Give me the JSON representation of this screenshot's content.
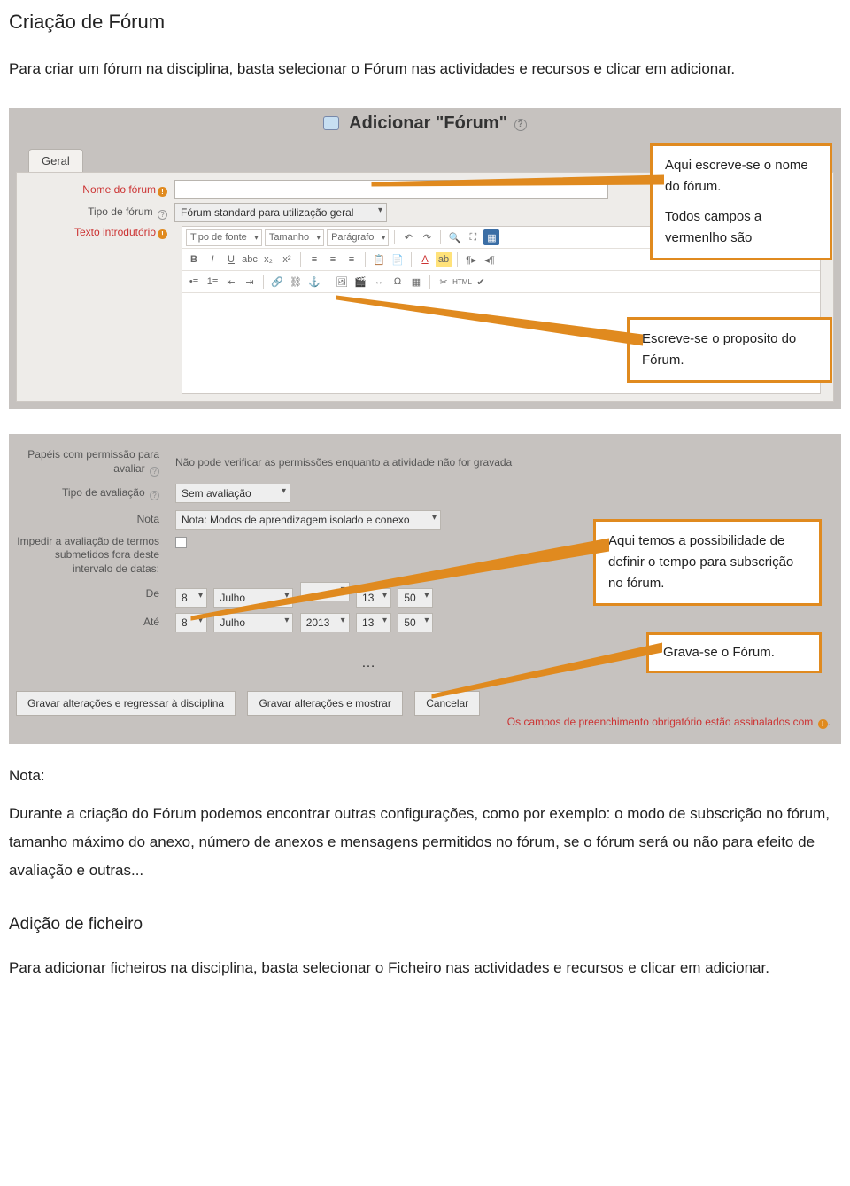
{
  "doc": {
    "title": "Criação de Fórum",
    "intro": "Para criar um fórum na disciplina, basta selecionar o Fórum nas actividades e recursos e clicar em adicionar.",
    "note_label": "Nota:",
    "note_body": "Durante a criação do Fórum podemos encontrar outras configurações, como por exemplo: o modo de subscrição no fórum, tamanho máximo do anexo, número de anexos e mensagens permitidos no fórum, se o fórum será ou não para efeito de avaliação e outras...",
    "section2_title": "Adição de ficheiro",
    "section2_body": "Para adicionar ficheiros na disciplina, basta selecionar o Ficheiro nas actividades e recursos e clicar em adicionar."
  },
  "callouts": {
    "c1": "Aqui escreve-se o nome do fórum.",
    "c1b": "Todos campos a vermenlho são",
    "c2": "Escreve-se o proposito do Fórum.",
    "c3": "Aqui temos a possibilidade de definir o tempo para subscrição no fórum.",
    "c4": "Grava-se o Fórum."
  },
  "shot1": {
    "heading": "Adicionar \"Fórum\"",
    "help_glyph": "?",
    "tab": "Geral",
    "labels": {
      "nome": "Nome do fórum",
      "tipo": "Tipo de fórum",
      "texto": "Texto introdutório"
    },
    "tipo_value": "Fórum standard para utilização geral",
    "editor": {
      "font_sel": "Tipo de fonte",
      "size_sel": "Tamanho",
      "para_sel": "Parágrafo"
    }
  },
  "shot2": {
    "labels": {
      "papeis": "Papéis com permissão para avaliar",
      "tipo_aval": "Tipo de avaliação",
      "nota": "Nota",
      "impedir": "Impedir a avaliação de termos submetidos fora deste intervalo de datas:",
      "de": "De",
      "ate": "Até"
    },
    "papeis_value": "Não pode verificar as permissões enquanto a atividade não for gravada",
    "tipo_aval_value": "Sem avaliação",
    "nota_value": "Nota: Modos de aprendizagem isolado e conexo",
    "dates": {
      "de": {
        "day": "8",
        "month": "Julho",
        "year_blank": " ",
        "hour": "13",
        "min": "50"
      },
      "ate": {
        "day": "8",
        "month": "Julho",
        "year": "2013",
        "hour": "13",
        "min": "50"
      }
    },
    "buttons": {
      "save_return": "Gravar alterações e regressar à disciplina",
      "save_show": "Gravar alterações e mostrar",
      "cancel": "Cancelar"
    },
    "footer": "Os campos de preenchimento obrigatório estão assinalados com",
    "ellipsis": "…"
  }
}
